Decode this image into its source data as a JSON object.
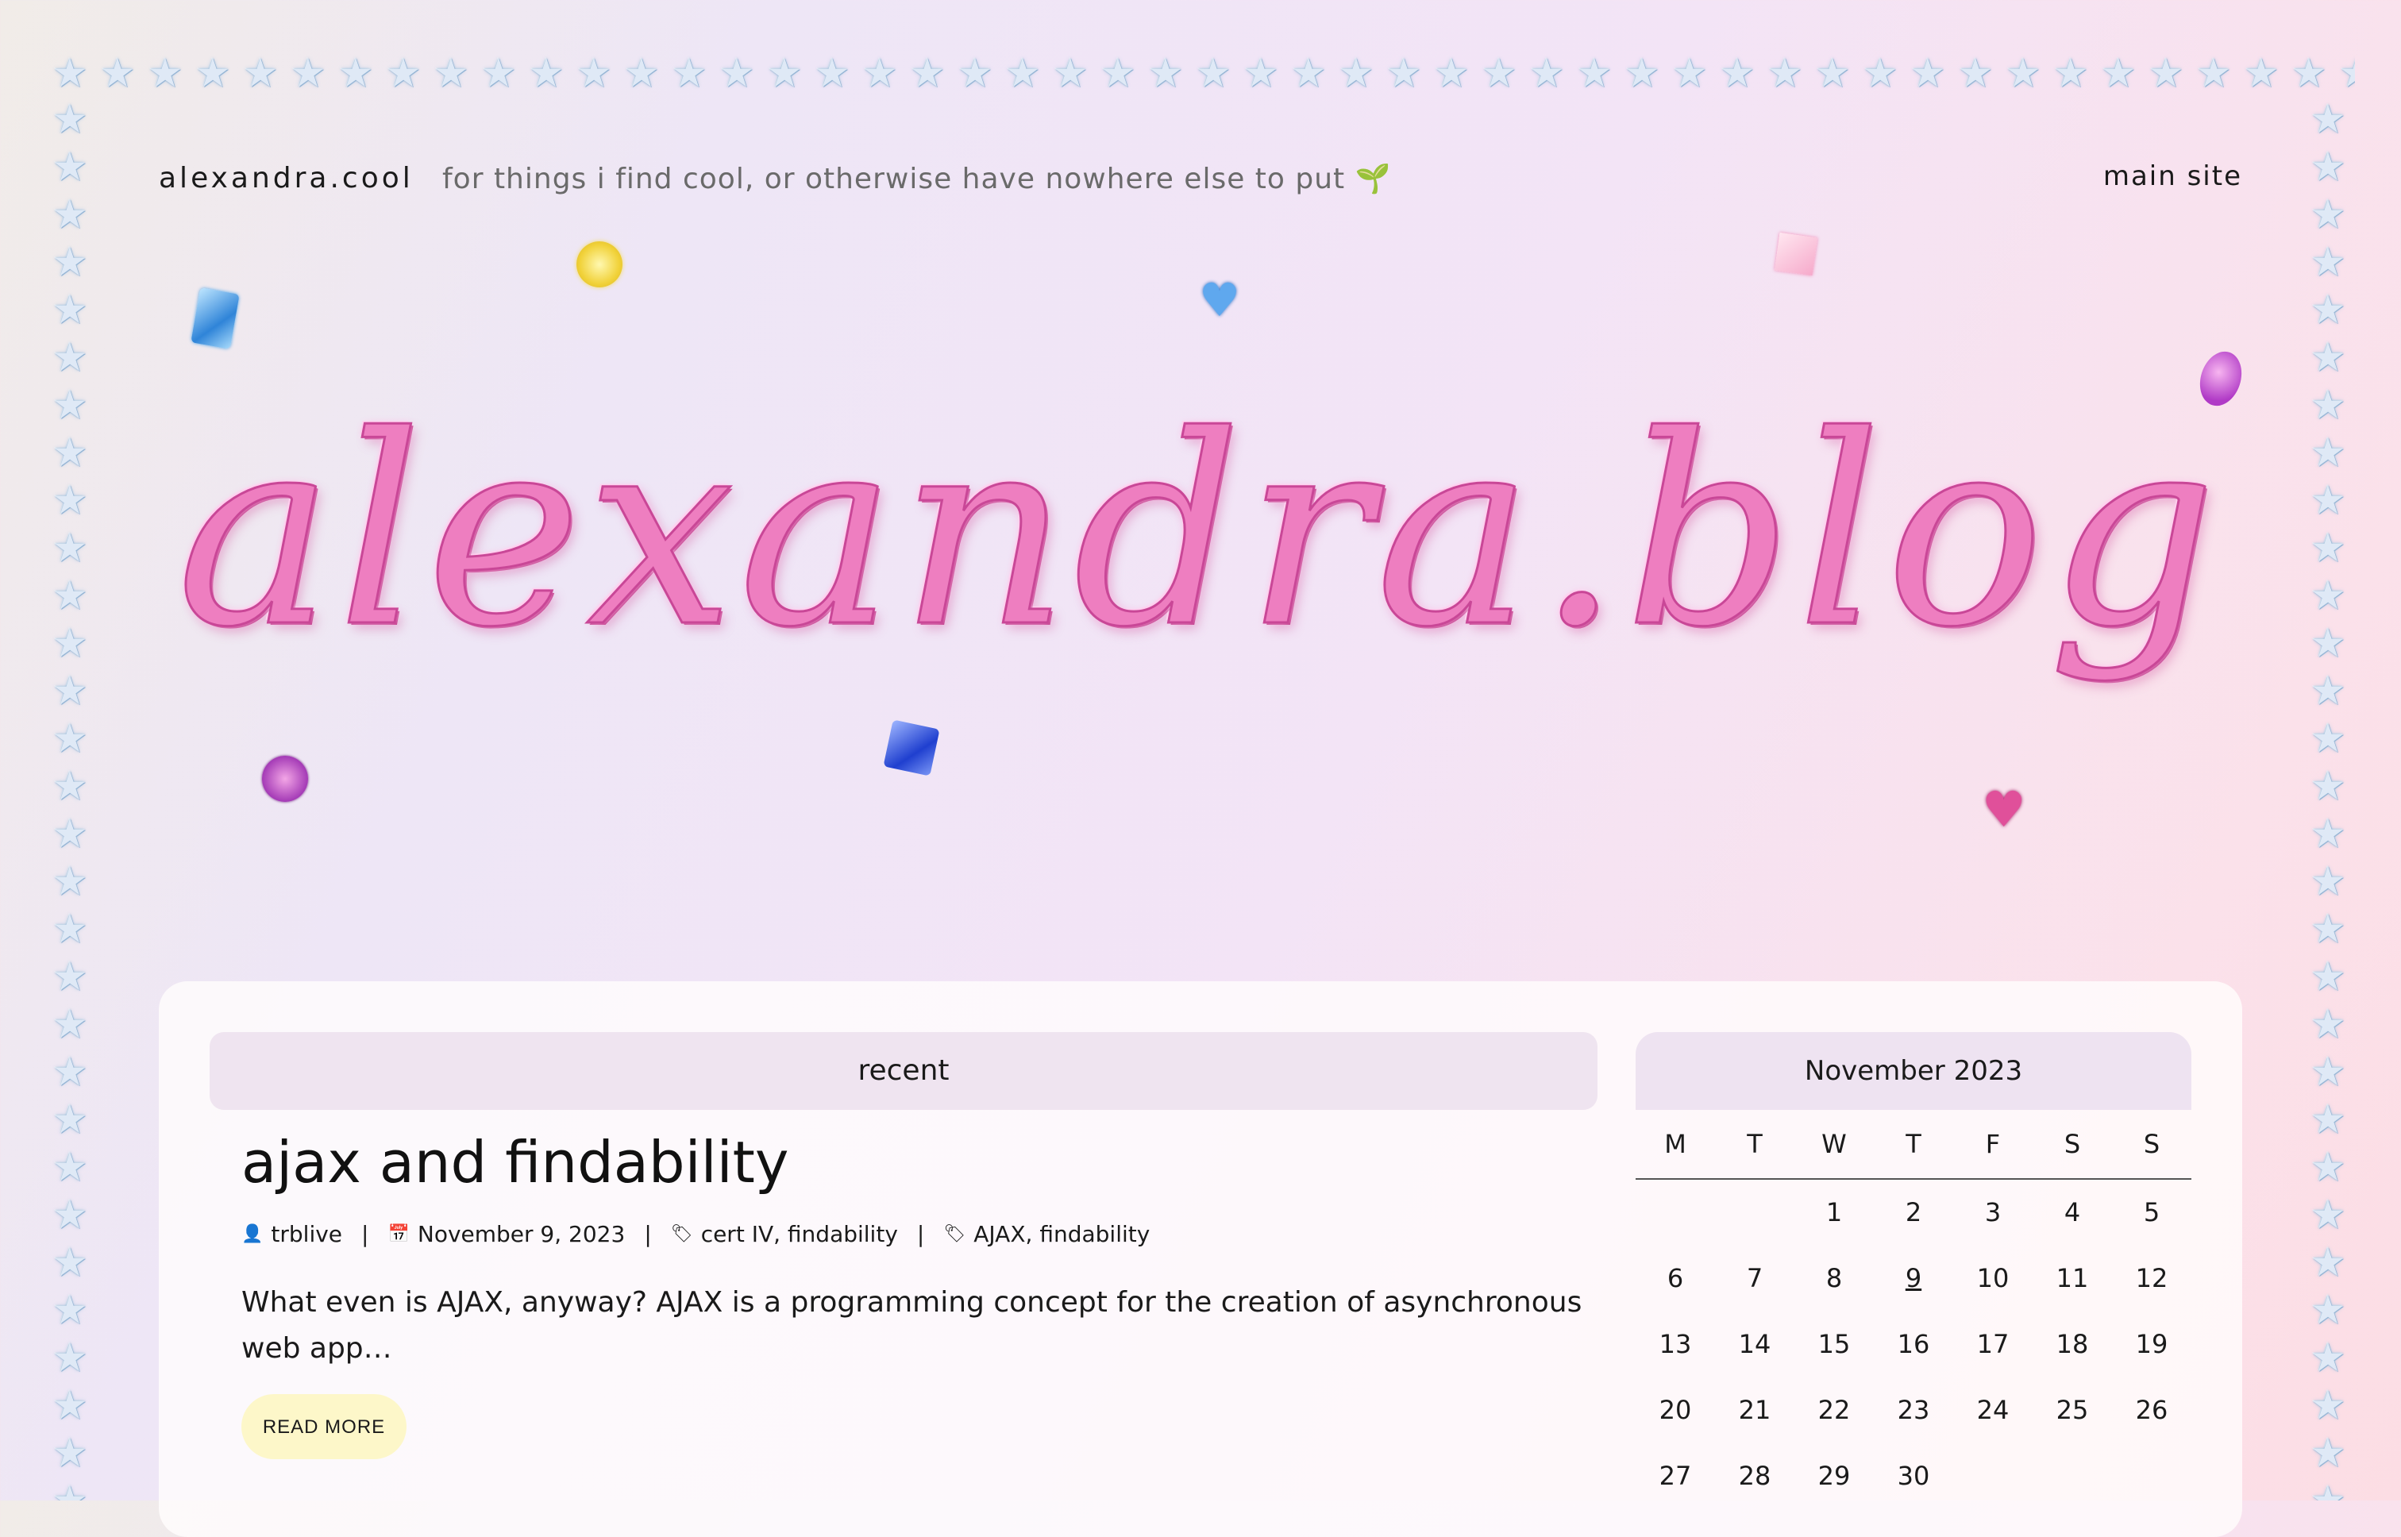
{
  "header": {
    "site_name": "alexandra.cool",
    "tagline": "for things i find cool, or otherwise have nowhere else to put",
    "tagline_emoji": "🌱",
    "main_site_link": "main site"
  },
  "hero": {
    "title": "alexandra.blog"
  },
  "colors": {
    "title_pink": "#ee7ec0",
    "panel": "#fffcfd",
    "recent_bar": "#efe4f0",
    "read_more_bg": "#fdf7c9",
    "star_border": "#dfe9f6"
  },
  "recent": {
    "heading": "recent",
    "post": {
      "title": "ajax and findability",
      "author": "trblive",
      "date": "November 9, 2023",
      "categories": "cert IV, findability",
      "tags": "AJAX, findability",
      "excerpt": "What even is AJAX, anyway? AJAX is a programming concept for the creation of asynchronous web app…",
      "read_more": "READ MORE"
    }
  },
  "calendar": {
    "month": "November 2023",
    "day_headers": [
      "M",
      "T",
      "W",
      "T",
      "F",
      "S",
      "S"
    ],
    "weeks": [
      [
        "",
        "",
        "1",
        "2",
        "3",
        "4",
        "5"
      ],
      [
        "6",
        "7",
        "8",
        "9",
        "10",
        "11",
        "12"
      ],
      [
        "13",
        "14",
        "15",
        "16",
        "17",
        "18",
        "19"
      ],
      [
        "20",
        "21",
        "22",
        "23",
        "24",
        "25",
        "26"
      ],
      [
        "27",
        "28",
        "29",
        "30",
        "",
        "",
        ""
      ]
    ],
    "linked_day": "9"
  }
}
